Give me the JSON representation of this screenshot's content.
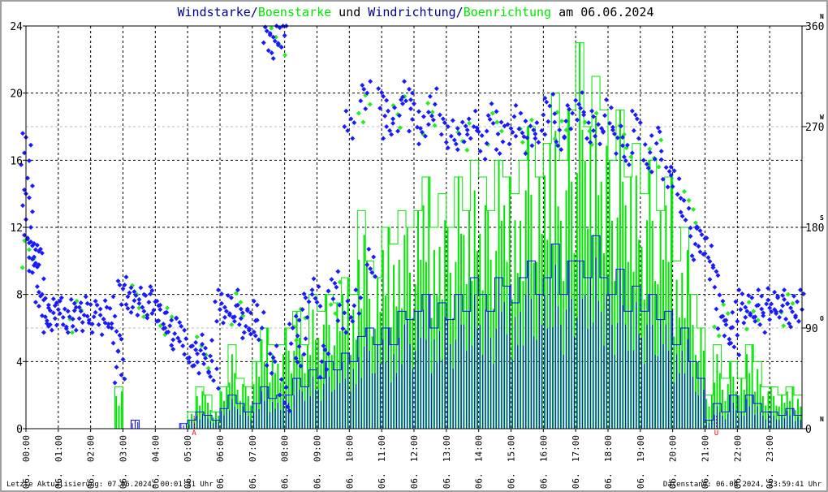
{
  "title": {
    "part1": "Windstarke",
    "sep1": "/",
    "part2": "Boenstarke",
    "part3": " und ",
    "part4": "Windrichtung",
    "sep2": "/",
    "part5": "Boenrichtung",
    "part6": " am 06.06.2024"
  },
  "footer": {
    "last_update": "Letzte Aktualisierung: 07.06.2024, 00:01:31 Uhr",
    "data_status": "Datenstand: 06.06.2024, 23:59:41 Uhr"
  },
  "colors": {
    "wind": "#0000ff",
    "gust": "#00e600",
    "dir": "#1a1aff",
    "gust_dir": "#22ee22",
    "sun": "#ff0000",
    "title_blue": "#00008b"
  },
  "chart_data": {
    "type": "line",
    "title": "Windstarke/Boenstarke und Windrichtung/Boenrichtung am 06.06.2024",
    "xlabel": "",
    "ylabel": "",
    "xlim": [
      0,
      24
    ],
    "ylim": [
      0,
      24
    ],
    "y2lim": [
      0,
      360
    ],
    "grid": true,
    "yticks": [
      0,
      4,
      8,
      12,
      16,
      20,
      24
    ],
    "y2ticks": [
      {
        "value": 0,
        "label": "0",
        "dir": "N"
      },
      {
        "value": 90,
        "label": "90",
        "dir": "O"
      },
      {
        "value": 180,
        "label": "180",
        "dir": "S"
      },
      {
        "value": 270,
        "label": "270",
        "dir": "W"
      },
      {
        "value": 360,
        "label": "360",
        "dir": "N"
      }
    ],
    "xtick_labels": [
      "06. 00:00",
      "06. 01:00",
      "06. 02:00",
      "06. 03:00",
      "06. 04:00",
      "06. 05:00",
      "06. 06:00",
      "06. 07:00",
      "06. 08:00",
      "06. 09:00",
      "06. 10:00",
      "06. 11:00",
      "06. 12:00",
      "06. 13:00",
      "06. 14:00",
      "06. 15:00",
      "06. 16:00",
      "06. 17:00",
      "06. 18:00",
      "06. 19:00",
      "06. 20:00",
      "06. 21:00",
      "06. 22:00",
      "06. 23:00"
    ],
    "markers": [
      {
        "hour": 5.2,
        "label": "A"
      },
      {
        "hour": 21.35,
        "label": "U"
      }
    ],
    "interval_hours": 0.25,
    "series": [
      {
        "name": "Windstarke",
        "values": [
          0,
          0,
          0,
          0,
          0,
          0,
          0,
          0,
          0,
          0,
          0,
          0,
          0,
          0.5,
          0,
          0,
          0,
          0,
          0,
          0.3,
          0.5,
          1,
          0.8,
          0.5,
          1.2,
          2,
          1.5,
          1,
          1.5,
          2.5,
          1.8,
          2,
          2,
          3,
          2.5,
          3.5,
          3,
          4,
          3.5,
          4.5,
          4,
          5.5,
          6,
          5,
          6,
          5,
          7,
          6.5,
          7,
          8,
          6,
          7.5,
          6.5,
          8,
          7,
          9,
          8,
          7,
          9,
          8.5,
          7.5,
          9,
          10,
          8,
          9,
          11,
          8,
          10,
          10,
          9,
          11.5,
          9,
          8,
          9.5,
          7,
          8.5,
          7,
          8,
          6.5,
          7,
          5,
          6,
          4,
          3,
          0.5,
          1.5,
          1,
          2,
          1,
          2,
          1.5,
          1,
          1,
          0.8,
          1.2,
          0.8
        ]
      },
      {
        "name": "Boenstarke",
        "values": [
          0,
          0,
          0,
          0,
          0,
          0,
          0,
          0,
          0,
          0,
          0,
          2.5,
          0,
          0,
          0,
          0,
          0,
          0,
          0,
          0,
          1,
          2.5,
          2,
          1,
          2.5,
          5,
          3,
          2.5,
          4,
          6,
          5,
          5,
          6,
          7,
          5,
          8,
          7,
          8,
          7.5,
          9,
          8,
          13,
          10,
          9,
          12,
          11,
          13,
          12,
          13,
          15,
          12,
          14,
          12,
          15,
          13,
          16,
          15,
          13,
          16,
          15,
          14,
          16,
          18,
          15,
          17,
          20,
          16,
          19,
          23,
          18,
          21,
          19,
          16,
          19,
          15,
          17,
          14,
          16,
          13,
          15,
          10,
          12,
          8,
          6,
          2,
          5,
          3,
          4,
          3,
          5,
          4,
          2.5,
          2.5,
          2,
          2.5,
          2
        ]
      }
    ],
    "direction_points": [
      [
        0.0,
        250
      ],
      [
        0.05,
        210
      ],
      [
        0.1,
        180
      ],
      [
        0.15,
        160
      ],
      [
        0.25,
        155
      ],
      [
        0.35,
        150
      ],
      [
        0.45,
        120
      ],
      [
        0.55,
        108
      ],
      [
        0.7,
        100
      ],
      [
        0.85,
        102
      ],
      [
        1.0,
        103
      ],
      [
        1.2,
        100
      ],
      [
        1.4,
        105
      ],
      [
        1.6,
        102
      ],
      [
        1.8,
        98
      ],
      [
        2.0,
        104
      ],
      [
        2.2,
        100
      ],
      [
        2.4,
        98
      ],
      [
        2.6,
        104
      ],
      [
        2.8,
        80
      ],
      [
        2.9,
        55
      ],
      [
        3.0,
        125
      ],
      [
        3.2,
        118
      ],
      [
        3.4,
        112
      ],
      [
        3.6,
        112
      ],
      [
        3.8,
        113
      ],
      [
        4.0,
        110
      ],
      [
        4.2,
        100
      ],
      [
        4.4,
        90
      ],
      [
        4.6,
        85
      ],
      [
        4.8,
        88
      ],
      [
        5.0,
        70
      ],
      [
        5.2,
        60
      ],
      [
        5.4,
        70
      ],
      [
        5.6,
        65
      ],
      [
        5.8,
        50
      ],
      [
        6.0,
        110
      ],
      [
        6.2,
        105
      ],
      [
        6.4,
        110
      ],
      [
        6.6,
        100
      ],
      [
        6.8,
        95
      ],
      [
        7.0,
        100
      ],
      [
        7.2,
        90
      ],
      [
        7.5,
        345
      ],
      [
        7.7,
        350
      ],
      [
        7.9,
        355
      ],
      [
        7.6,
        60
      ],
      [
        8.0,
        30
      ],
      [
        8.3,
        90
      ],
      [
        8.5,
        70
      ],
      [
        8.7,
        110
      ],
      [
        9.0,
        120
      ],
      [
        9.2,
        60
      ],
      [
        9.5,
        130
      ],
      [
        9.8,
        100
      ],
      [
        10.0,
        270
      ],
      [
        10.2,
        110
      ],
      [
        10.5,
        300
      ],
      [
        10.7,
        150
      ],
      [
        11.0,
        290
      ],
      [
        11.2,
        270
      ],
      [
        11.5,
        280
      ],
      [
        11.8,
        300
      ],
      [
        12.0,
        280
      ],
      [
        12.3,
        265
      ],
      [
        12.6,
        290
      ],
      [
        12.9,
        270
      ],
      [
        13.2,
        265
      ],
      [
        13.5,
        260
      ],
      [
        13.8,
        270
      ],
      [
        14.1,
        255
      ],
      [
        14.4,
        280
      ],
      [
        14.7,
        260
      ],
      [
        15.0,
        265
      ],
      [
        15.3,
        275
      ],
      [
        15.6,
        260
      ],
      [
        15.9,
        270
      ],
      [
        16.2,
        285
      ],
      [
        16.5,
        260
      ],
      [
        16.8,
        275
      ],
      [
        17.1,
        290
      ],
      [
        17.4,
        270
      ],
      [
        17.7,
        265
      ],
      [
        18.0,
        280
      ],
      [
        18.3,
        260
      ],
      [
        18.6,
        250
      ],
      [
        18.9,
        270
      ],
      [
        19.2,
        240
      ],
      [
        19.5,
        255
      ],
      [
        19.8,
        230
      ],
      [
        20.1,
        220
      ],
      [
        20.4,
        190
      ],
      [
        20.7,
        165
      ],
      [
        20.9,
        170
      ],
      [
        21.1,
        160
      ],
      [
        21.3,
        130
      ],
      [
        21.5,
        100
      ],
      [
        21.7,
        90
      ],
      [
        21.9,
        80
      ],
      [
        22.1,
        110
      ],
      [
        22.3,
        105
      ],
      [
        22.5,
        110
      ],
      [
        22.7,
        100
      ],
      [
        22.9,
        115
      ],
      [
        23.1,
        108
      ],
      [
        23.3,
        110
      ],
      [
        23.5,
        105
      ],
      [
        23.7,
        108
      ],
      [
        23.9,
        110
      ]
    ],
    "gust_direction_points": [
      [
        0.1,
        160
      ],
      [
        1.5,
        102
      ],
      [
        3.5,
        112
      ],
      [
        4.3,
        100
      ],
      [
        5.5,
        70
      ],
      [
        6.5,
        105
      ],
      [
        7.8,
        350
      ],
      [
        8.5,
        95
      ],
      [
        9.5,
        115
      ],
      [
        10.5,
        290
      ],
      [
        11.5,
        285
      ],
      [
        12.5,
        275
      ],
      [
        13.5,
        265
      ],
      [
        14.5,
        270
      ],
      [
        15.5,
        260
      ],
      [
        16.5,
        275
      ],
      [
        17.5,
        270
      ],
      [
        18.5,
        255
      ],
      [
        19.5,
        250
      ],
      [
        20.5,
        200
      ],
      [
        21.5,
        95
      ],
      [
        22.5,
        105
      ],
      [
        23.5,
        108
      ]
    ]
  }
}
